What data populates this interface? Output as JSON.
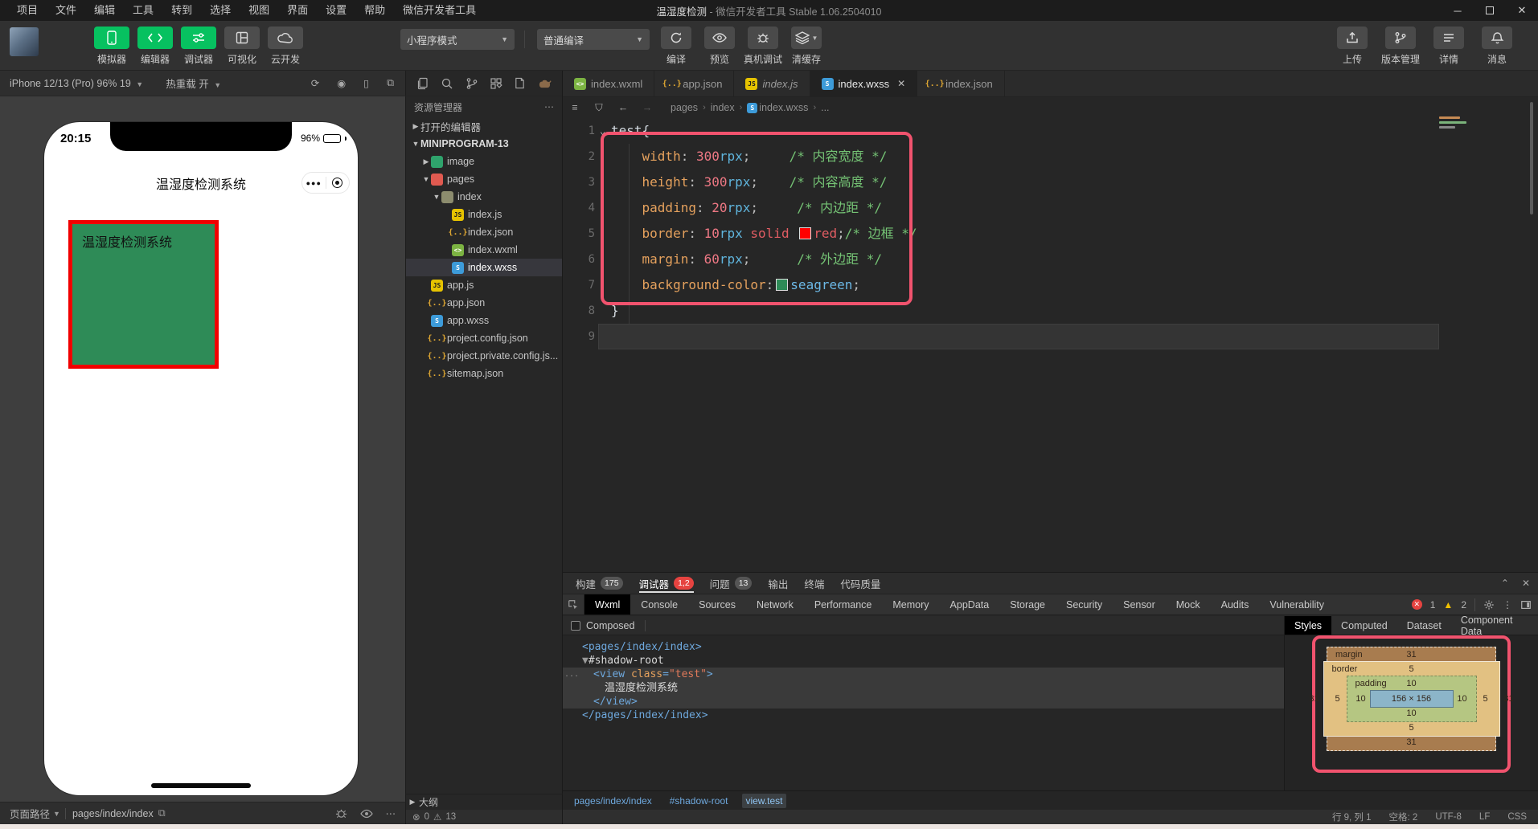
{
  "window_title_app": "温湿度检测",
  "window_title_rest": " - 微信开发者工具 Stable 1.06.2504010",
  "menu_bar": {
    "items": [
      "项目",
      "文件",
      "编辑",
      "工具",
      "转到",
      "选择",
      "视图",
      "界面",
      "设置",
      "帮助",
      "微信开发者工具"
    ]
  },
  "toolbar": {
    "app_buttons": [
      {
        "label": "模拟器",
        "icon": "phone",
        "variant": "green"
      },
      {
        "label": "编辑器",
        "icon": "code",
        "variant": "green"
      },
      {
        "label": "调试器",
        "icon": "tune",
        "variant": "green"
      },
      {
        "label": "可视化",
        "icon": "layout",
        "variant": "gray"
      },
      {
        "label": "云开发",
        "icon": "cloud",
        "variant": "gray"
      }
    ],
    "mode_dropdown": "小程序模式",
    "compile_dropdown": "普通编译",
    "compile_actions": [
      {
        "label": "编译",
        "icon": "refresh"
      },
      {
        "label": "预览",
        "icon": "eye"
      },
      {
        "label": "真机调试",
        "icon": "bug"
      },
      {
        "label": "清缓存",
        "icon": "layers",
        "caret": true
      }
    ],
    "right_actions": [
      {
        "label": "上传",
        "icon": "upload"
      },
      {
        "label": "版本管理",
        "icon": "branch"
      },
      {
        "label": "详情",
        "icon": "list"
      },
      {
        "label": "消息",
        "icon": "bell"
      }
    ]
  },
  "simulator": {
    "device": "iPhone 12/13 (Pro) 96% 19",
    "hot_reload": "热重载 开",
    "time": "20:15",
    "battery": "96%",
    "nav_title": "温湿度检测系统",
    "box_text": "温湿度检测系统",
    "page_path_label": "页面路径",
    "page_path": "pages/index/index"
  },
  "explorer": {
    "title": "资源管理器",
    "outline": "大纲",
    "errors": "0",
    "warnings": "13",
    "tree": [
      {
        "label": "打开的编辑器",
        "indent": 0,
        "arrow": "right"
      },
      {
        "label": "MINIPROGRAM-13",
        "indent": 0,
        "arrow": "down",
        "bold": true
      },
      {
        "label": "image",
        "indent": 1,
        "arrow": "right",
        "icon": "folder-image"
      },
      {
        "label": "pages",
        "indent": 1,
        "arrow": "down",
        "icon": "folder-pages"
      },
      {
        "label": "index",
        "indent": 2,
        "arrow": "down",
        "icon": "folder"
      },
      {
        "label": "index.js",
        "indent": 3,
        "icon": "js"
      },
      {
        "label": "index.json",
        "indent": 3,
        "icon": "json"
      },
      {
        "label": "index.wxml",
        "indent": 3,
        "icon": "wxml"
      },
      {
        "label": "index.wxss",
        "indent": 3,
        "icon": "wxss",
        "selected": true
      },
      {
        "label": "app.js",
        "indent": 1,
        "icon": "js"
      },
      {
        "label": "app.json",
        "indent": 1,
        "icon": "json"
      },
      {
        "label": "app.wxss",
        "indent": 1,
        "icon": "wxss"
      },
      {
        "label": "project.config.json",
        "indent": 1,
        "icon": "json"
      },
      {
        "label": "project.private.config.js...",
        "indent": 1,
        "icon": "json"
      },
      {
        "label": "sitemap.json",
        "indent": 1,
        "icon": "json"
      }
    ]
  },
  "editor": {
    "tabs": [
      {
        "name": "index.wxml",
        "icon": "wxml"
      },
      {
        "name": "app.json",
        "icon": "json"
      },
      {
        "name": "index.js",
        "icon": "js",
        "italic": true
      },
      {
        "name": "index.wxss",
        "icon": "wxss",
        "active": true,
        "close": true
      },
      {
        "name": "index.json",
        "icon": "json"
      }
    ],
    "breadcrumb": [
      "pages",
      "index",
      "index.wxss",
      "..."
    ],
    "lines": [
      {
        "num": "1",
        "fold": true,
        "tokens": [
          {
            "t": "test{",
            "c": "sel"
          }
        ]
      },
      {
        "num": "2",
        "tokens": [
          {
            "t": "    ",
            "c": "pln"
          },
          {
            "t": "width",
            "c": "prop"
          },
          {
            "t": ": ",
            "c": "pln"
          },
          {
            "t": "300",
            "c": "num"
          },
          {
            "t": "rpx",
            "c": "unit"
          },
          {
            "t": ";",
            "c": "pln"
          },
          {
            "t": "     ",
            "c": "pln"
          },
          {
            "t": "/* 内容宽度 */",
            "c": "com"
          }
        ]
      },
      {
        "num": "3",
        "tokens": [
          {
            "t": "    ",
            "c": "pln"
          },
          {
            "t": "height",
            "c": "prop"
          },
          {
            "t": ": ",
            "c": "pln"
          },
          {
            "t": "300",
            "c": "num"
          },
          {
            "t": "rpx",
            "c": "unit"
          },
          {
            "t": ";",
            "c": "pln"
          },
          {
            "t": "    ",
            "c": "pln"
          },
          {
            "t": "/* 内容高度 */",
            "c": "com"
          }
        ]
      },
      {
        "num": "4",
        "tokens": [
          {
            "t": "    ",
            "c": "pln"
          },
          {
            "t": "padding",
            "c": "prop"
          },
          {
            "t": ": ",
            "c": "pln"
          },
          {
            "t": "20",
            "c": "num"
          },
          {
            "t": "rpx",
            "c": "unit"
          },
          {
            "t": ";",
            "c": "pln"
          },
          {
            "t": "     ",
            "c": "pln"
          },
          {
            "t": "/* 内边距 */",
            "c": "com"
          }
        ]
      },
      {
        "num": "5",
        "tokens": [
          {
            "t": "    ",
            "c": "pln"
          },
          {
            "t": "border",
            "c": "prop"
          },
          {
            "t": ": ",
            "c": "pln"
          },
          {
            "t": "10",
            "c": "num"
          },
          {
            "t": "rpx",
            "c": "unit"
          },
          {
            "t": " ",
            "c": "pln"
          },
          {
            "t": "solid",
            "c": "kw"
          },
          {
            "t": " ",
            "c": "pln"
          },
          {
            "sw": "#ff0000"
          },
          {
            "t": "red",
            "c": "kw"
          },
          {
            "t": ";",
            "c": "pln"
          },
          {
            "t": "/* 边框 */",
            "c": "com"
          }
        ]
      },
      {
        "num": "6",
        "tokens": [
          {
            "t": "    ",
            "c": "pln"
          },
          {
            "t": "margin",
            "c": "prop"
          },
          {
            "t": ": ",
            "c": "pln"
          },
          {
            "t": "60",
            "c": "num"
          },
          {
            "t": "rpx",
            "c": "unit"
          },
          {
            "t": ";",
            "c": "pln"
          },
          {
            "t": "      ",
            "c": "pln"
          },
          {
            "t": "/* 外边距 */",
            "c": "com"
          }
        ]
      },
      {
        "num": "7",
        "tokens": [
          {
            "t": "    ",
            "c": "pln"
          },
          {
            "t": "background-color",
            "c": "prop"
          },
          {
            "t": ":",
            "c": "pln"
          },
          {
            "sw": "#2e8b57"
          },
          {
            "t": "seagreen",
            "c": "color"
          },
          {
            "t": ";",
            "c": "pln"
          }
        ]
      },
      {
        "num": "8",
        "tokens": [
          {
            "t": "}",
            "c": "sel"
          }
        ]
      },
      {
        "num": "9",
        "current": true,
        "tokens": []
      }
    ],
    "annotation_color": "#f1536e"
  },
  "debugger": {
    "panel_tabs": [
      {
        "label": "构建",
        "badge": "175",
        "badge_type": "gray"
      },
      {
        "label": "调试器",
        "badge": "1,2",
        "badge_type": "red",
        "active": true
      },
      {
        "label": "问题",
        "badge": "13",
        "badge_type": "gray"
      },
      {
        "label": "输出"
      },
      {
        "label": "终端"
      },
      {
        "label": "代码质量"
      }
    ],
    "devtools_tabs": [
      "Wxml",
      "Console",
      "Sources",
      "Network",
      "Performance",
      "Memory",
      "AppData",
      "Storage",
      "Security",
      "Sensor",
      "Mock",
      "Audits",
      "Vulnerability"
    ],
    "active_devtools_tab": "Wxml",
    "composed": "Composed",
    "error_count": "1",
    "warn_count": "2",
    "wxml": [
      {
        "indent": 1,
        "tokens": [
          {
            "t": "<pages/index/index>",
            "c": "tag"
          }
        ]
      },
      {
        "indent": 1,
        "tokens": [
          {
            "t": "▼",
            "c": "arrow"
          },
          {
            "t": "#shadow-root",
            "c": "shadow"
          }
        ]
      },
      {
        "indent": 2,
        "sel": true,
        "gutter": "...",
        "tokens": [
          {
            "t": "<view ",
            "c": "tag"
          },
          {
            "t": "class",
            "c": "attr"
          },
          {
            "t": "=",
            "c": "tag"
          },
          {
            "t": "\"test\"",
            "c": "val"
          },
          {
            "t": ">",
            "c": "tag"
          }
        ]
      },
      {
        "indent": 3,
        "sel": true,
        "tokens": [
          {
            "t": "温湿度检测系统",
            "c": "plain"
          }
        ]
      },
      {
        "indent": 2,
        "sel": true,
        "tokens": [
          {
            "t": "</view>",
            "c": "tag"
          }
        ]
      },
      {
        "indent": 1,
        "tokens": [
          {
            "t": "</pages/index/index>",
            "c": "tag"
          }
        ]
      }
    ],
    "crumbs": [
      "pages/index/index",
      "#shadow-root",
      "view.test"
    ],
    "styles_tabs": [
      "Styles",
      "Computed",
      "Dataset",
      "Component Data"
    ],
    "box_model": {
      "margin_label": "margin",
      "border_label": "border",
      "padding_label": "padding",
      "margin": "31",
      "border": "5",
      "padding": "10",
      "content": "156 × 156"
    }
  },
  "status": {
    "segments": [
      "行 9, 列 1",
      "空格: 2",
      "UTF-8",
      "LF",
      "CSS"
    ]
  }
}
